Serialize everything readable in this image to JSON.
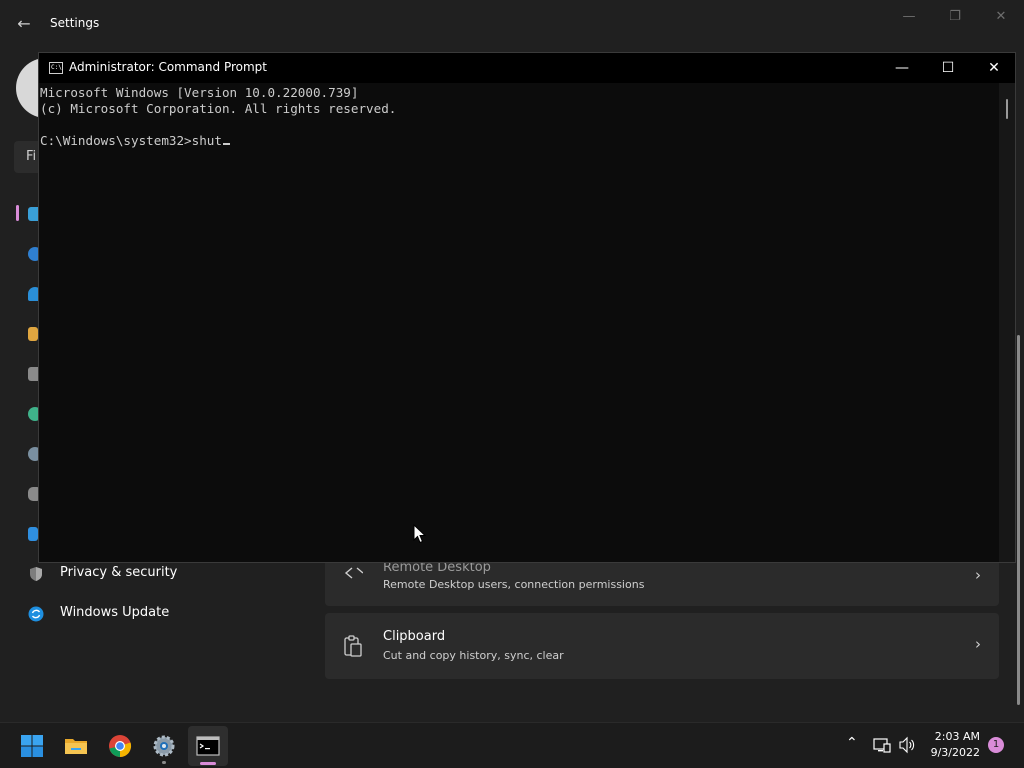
{
  "settings": {
    "title": "Settings",
    "search_placeholder": "Fi",
    "nav": [
      {
        "label": "Privacy & security",
        "icon": "shield-icon"
      },
      {
        "label": "Windows Update",
        "icon": "windows-update-icon"
      }
    ],
    "cards": [
      {
        "title": "Remote Desktop",
        "subtitle": "Remote Desktop users, connection permissions",
        "icon": "remote-desktop-icon"
      },
      {
        "title": "Clipboard",
        "subtitle": "Cut and copy history, sync, clear",
        "icon": "clipboard-icon"
      }
    ]
  },
  "cmd": {
    "title": "Administrator: Command Prompt",
    "lines": [
      "Microsoft Windows [Version 10.0.22000.739]",
      "(c) Microsoft Corporation. All rights reserved.",
      "",
      "C:\\Windows\\system32>shut"
    ]
  },
  "taskbar": {
    "time": "2:03 AM",
    "date": "9/3/2022",
    "notification_count": "1",
    "apps": [
      "start",
      "file-explorer",
      "chrome",
      "settings",
      "command-prompt"
    ]
  },
  "colors": {
    "accent": "#d98cd8",
    "terminal_bg": "#0c0c0c",
    "terminal_text": "#cccccc",
    "window_bg": "#202020"
  }
}
